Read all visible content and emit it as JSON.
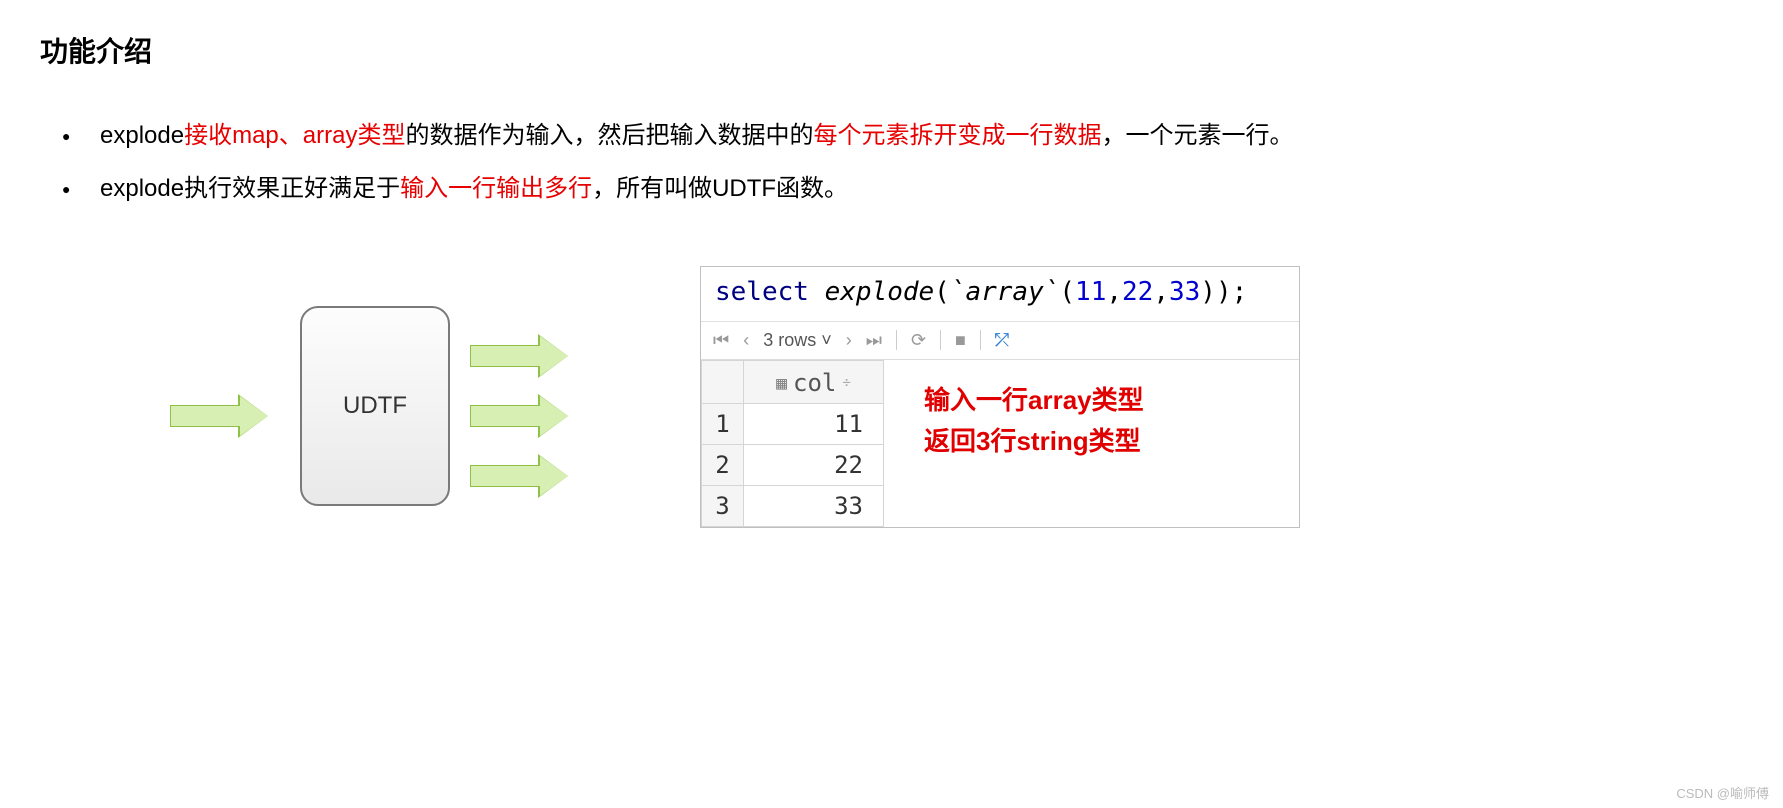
{
  "heading": "功能介绍",
  "bullets": {
    "b1": {
      "p1": "explode",
      "p2": "接收map、array类型",
      "p3": "的数据作为输入，然后把输入数据中的",
      "p4": "每个元素拆开变成一行数据",
      "p5": "，一个元素一行。"
    },
    "b2": {
      "p1": "explode执行效果正好满足于",
      "p2": "输入一行输出多行",
      "p3": "，所有叫做UDTF函数。"
    }
  },
  "diagram": {
    "box_label": "UDTF"
  },
  "code": {
    "kw": "select",
    "fn": "explode",
    "open": "(",
    "arr": "`array`",
    "open2": "(",
    "n1": "11",
    "c1": ",",
    "n2": "22",
    "c2": ",",
    "n3": "33",
    "close": "));"
  },
  "toolbar": {
    "rows": "3 rows"
  },
  "table": {
    "col_label": "col",
    "rows": [
      {
        "idx": "1",
        "val": "11"
      },
      {
        "idx": "2",
        "val": "22"
      },
      {
        "idx": "3",
        "val": "33"
      }
    ]
  },
  "annot": {
    "l1": "输入一行array类型",
    "l2": "返回3行string类型"
  },
  "watermark": "CSDN @喻师傅"
}
